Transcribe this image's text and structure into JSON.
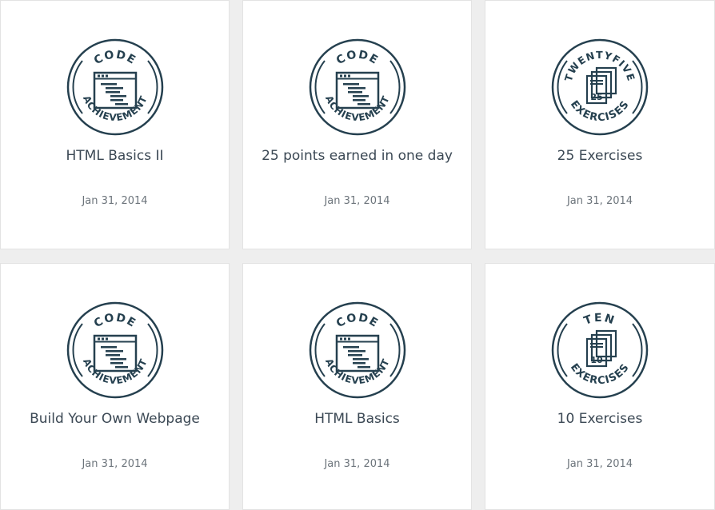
{
  "colors": {
    "badge": "#25404f",
    "title": "#3b4854",
    "date": "#6c747b",
    "background": "#eeeeee",
    "card": "#ffffff"
  },
  "achievements": [
    {
      "title": "HTML Basics II",
      "date": "Jan 31, 2014",
      "badge": {
        "kind": "code",
        "top": "CODE",
        "bottom": "ACHIEVEMENT",
        "icon": "code-window-icon"
      }
    },
    {
      "title": "25 points earned in one day",
      "date": "Jan 31, 2014",
      "badge": {
        "kind": "code",
        "top": "CODE",
        "bottom": "ACHIEVEMENT",
        "icon": "code-window-icon"
      }
    },
    {
      "title": "25 Exercises",
      "date": "Jan 31, 2014",
      "badge": {
        "kind": "exercises",
        "top": "TWENTYFIVE",
        "bottom": "EXERCISES",
        "number": "25",
        "icon": "stacked-pages-icon"
      }
    },
    {
      "title": "Build Your Own Webpage",
      "date": "Jan 31, 2014",
      "badge": {
        "kind": "code",
        "top": "CODE",
        "bottom": "ACHIEVEMENT",
        "icon": "code-window-icon"
      }
    },
    {
      "title": "HTML Basics",
      "date": "Jan 31, 2014",
      "badge": {
        "kind": "code",
        "top": "CODE",
        "bottom": "ACHIEVEMENT",
        "icon": "code-window-icon"
      }
    },
    {
      "title": "10 Exercises",
      "date": "Jan 31, 2014",
      "badge": {
        "kind": "exercises",
        "top": "TEN",
        "bottom": "EXERCISES",
        "number": "10",
        "icon": "stacked-pages-icon"
      }
    }
  ]
}
